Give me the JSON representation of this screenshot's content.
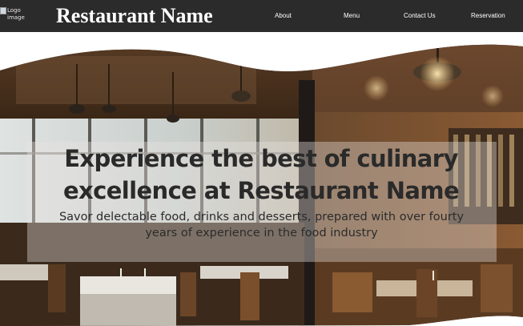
{
  "header": {
    "logo_alt": "Logo image",
    "brand": "Restaurant Name",
    "nav": {
      "about": "About",
      "menu": "Menu",
      "contact": "Contact Us",
      "reservation": "Reservation"
    }
  },
  "hero": {
    "headline": "Experience the best of culinary excellence at Restaurant Name",
    "subhead": "Savor delectable food, drinks and desserts, prepared with over fourty years of experience in the food industry",
    "image_description": "restaurant-interior-photo"
  },
  "colors": {
    "navbar_bg": "#2b2b2b",
    "nav_text": "#ffffff",
    "headline_text": "#2a2a2a",
    "page_bg": "#ffffff"
  }
}
